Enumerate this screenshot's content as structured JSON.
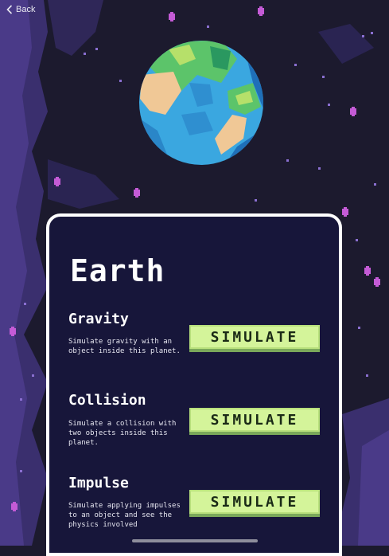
{
  "nav": {
    "back_label": "Back"
  },
  "planet": {
    "name": "Earth"
  },
  "sections": [
    {
      "title": "Gravity",
      "description": "Simulate gravity with an object inside this planet.",
      "button": "SIMULATE"
    },
    {
      "title": "Collision",
      "description": "Simulate a collision with two objects inside this planet.",
      "button": "SIMULATE"
    },
    {
      "title": "Impulse",
      "description": "Simulate applying impulses to an object and see the physics involved",
      "button": "SIMULATE"
    }
  ],
  "colors": {
    "background": "#1c1a2e",
    "nebula": "#3d2f73",
    "card": "#17163a",
    "button": "#d4f49a",
    "star": "#c45bd6",
    "ocean": "#3aa7e0",
    "land_green": "#5cc46a",
    "land_sand": "#f0c896"
  }
}
